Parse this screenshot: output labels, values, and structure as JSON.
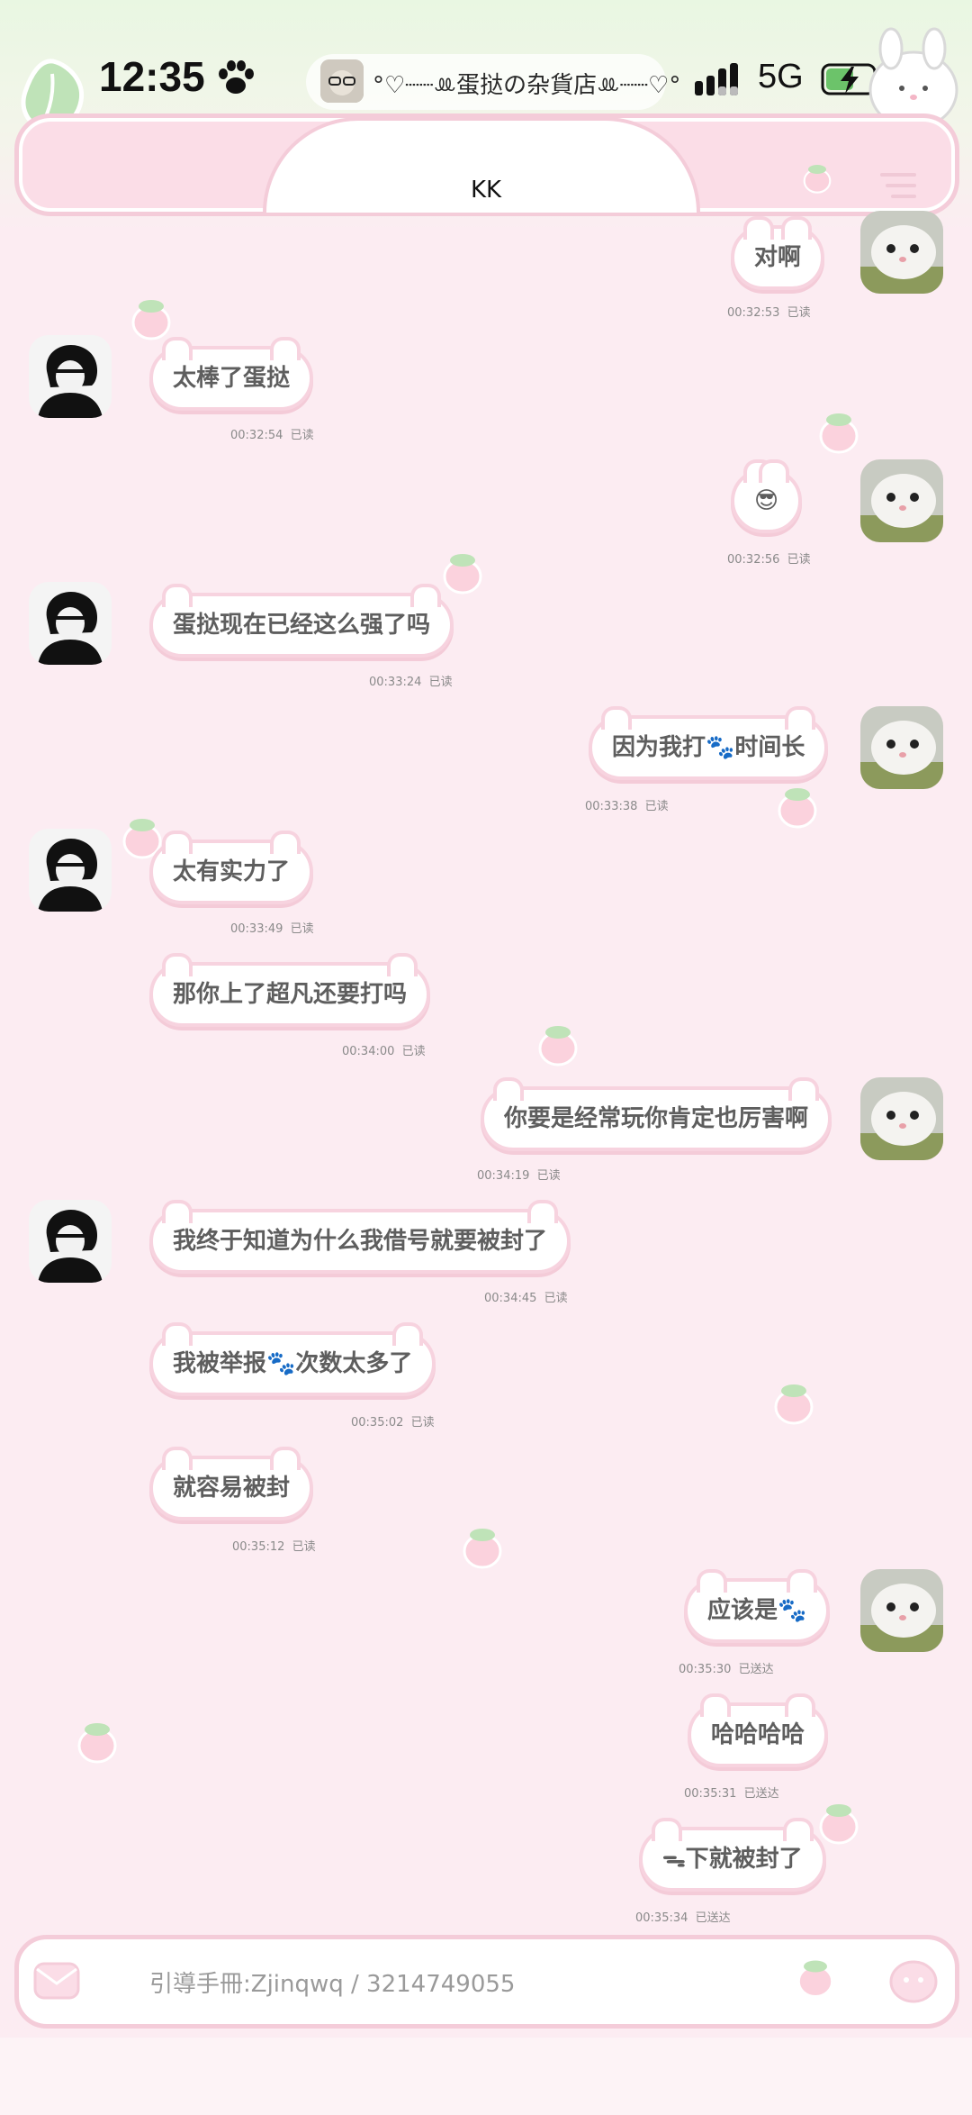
{
  "status_bar": {
    "time": "12:35",
    "title": "°♡┈┈ꔛ蛋挞の杂貨店ꔛ┈┈♡°",
    "network": "5G"
  },
  "header": {
    "title": "KK"
  },
  "messages": [
    {
      "side": "right",
      "text": "对啊",
      "time": "00:32:53",
      "status": "已读"
    },
    {
      "side": "left",
      "text": "太棒了蛋挞",
      "time": "00:32:54",
      "status": "已读"
    },
    {
      "side": "right",
      "text": "😎",
      "time": "00:32:56",
      "status": "已读"
    },
    {
      "side": "left",
      "text": "蛋挞现在已经这么强了吗",
      "time": "00:33:24",
      "status": "已读"
    },
    {
      "side": "right",
      "text": "因为我打🐾时间长",
      "time": "00:33:38",
      "status": "已读"
    },
    {
      "side": "left",
      "text": "太有实力了",
      "time": "00:33:49",
      "status": "已读"
    },
    {
      "side": "left",
      "text": "那你上了超凡还要打吗",
      "time": "00:34:00",
      "status": "已读"
    },
    {
      "side": "right",
      "text": "你要是经常玩你肯定也厉害啊",
      "time": "00:34:19",
      "status": "已读"
    },
    {
      "side": "left",
      "text": "我终于知道为什么我借号就要被封了",
      "time": "00:34:45",
      "status": "已读"
    },
    {
      "side": "left",
      "text": "我被举报🐾次数太多了",
      "time": "00:35:02",
      "status": "已读"
    },
    {
      "side": "left",
      "text": "就容易被封",
      "time": "00:35:12",
      "status": "已读"
    },
    {
      "side": "right",
      "text": "应该是🐾",
      "time": "00:35:30",
      "status": "已送达"
    },
    {
      "side": "right",
      "text": "哈哈哈哈",
      "time": "00:35:31",
      "status": "已送达"
    },
    {
      "side": "right",
      "text": "ᯓ下就被封了",
      "time": "00:35:34",
      "status": "已送达"
    }
  ],
  "input": {
    "placeholder": "引導手冊:Zjinqwq  /  3214749055"
  },
  "colors": {
    "background": "#fcecf2",
    "bubble_border": "#f7d3df",
    "accent_green": "#a8d9a0"
  }
}
